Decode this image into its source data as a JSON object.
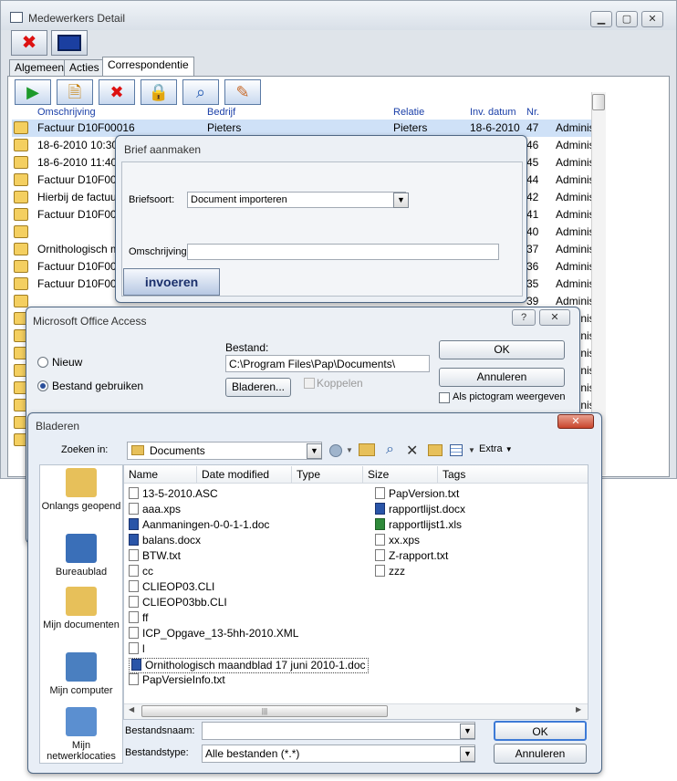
{
  "main_window": {
    "title": "Medewerkers Detail",
    "caption_min": "▁",
    "caption_max": "▢",
    "caption_close": "✕"
  },
  "tabs": [
    "Algemeen",
    "Acties",
    "Correspondentie"
  ],
  "grid": {
    "headers": {
      "omschrijving": "Omschrijving",
      "bedrijf": "Bedrijf",
      "relatie": "Relatie",
      "inv_datum": "Inv. datum",
      "nr": "Nr."
    },
    "rows": [
      {
        "omschrijving": "Factuur D10F00016",
        "bedrijf": "Pieters",
        "relatie": "Pieters",
        "datum": "18-6-2010",
        "nr": "47",
        "extra": "Administ"
      },
      {
        "omschrijving": "18-6-2010 10:30:0",
        "bedrijf": "",
        "relatie": "",
        "datum": "",
        "nr": "46",
        "extra": "Administ"
      },
      {
        "omschrijving": "18-6-2010 11:40:5",
        "bedrijf": "",
        "relatie": "",
        "datum": "",
        "nr": "45",
        "extra": "Administ"
      },
      {
        "omschrijving": "Factuur D10F0001",
        "bedrijf": "",
        "relatie": "",
        "datum": "",
        "nr": "44",
        "extra": "Administ"
      },
      {
        "omschrijving": "Hierbij de factuur v",
        "bedrijf": "",
        "relatie": "",
        "datum": "",
        "nr": "42",
        "extra": "Administ"
      },
      {
        "omschrijving": "Factuur D10F0001",
        "bedrijf": "",
        "relatie": "",
        "datum": "",
        "nr": "41",
        "extra": "Administ"
      },
      {
        "omschrijving": "",
        "bedrijf": "",
        "relatie": "",
        "datum": "",
        "nr": "40",
        "extra": "Administ"
      },
      {
        "omschrijving": "Ornithologisch maa",
        "bedrijf": "",
        "relatie": "",
        "datum": "",
        "nr": "37",
        "extra": "Administ"
      },
      {
        "omschrijving": "Factuur D10F0000",
        "bedrijf": "",
        "relatie": "",
        "datum": "",
        "nr": "36",
        "extra": "Administ"
      },
      {
        "omschrijving": "Factuur D10F0001",
        "bedrijf": "",
        "relatie": "",
        "datum": "",
        "nr": "35",
        "extra": "Administ"
      },
      {
        "omschrijving": "",
        "bedrijf": "",
        "relatie": "",
        "datum": "",
        "nr": "39",
        "extra": "Administ"
      },
      {
        "omschrijving": "",
        "bedrijf": "",
        "relatie": "",
        "datum": "",
        "nr": "",
        "extra": "Administ"
      },
      {
        "omschrijving": "",
        "bedrijf": "",
        "relatie": "",
        "datum": "",
        "nr": "",
        "extra": "Administ"
      },
      {
        "omschrijving": "",
        "bedrijf": "",
        "relatie": "",
        "datum": "",
        "nr": "",
        "extra": "Administ"
      },
      {
        "omschrijving": "",
        "bedrijf": "",
        "relatie": "",
        "datum": "",
        "nr": "",
        "extra": "Administ"
      },
      {
        "omschrijving": "",
        "bedrijf": "",
        "relatie": "",
        "datum": "",
        "nr": "",
        "extra": "Administ"
      },
      {
        "omschrijving": "",
        "bedrijf": "",
        "relatie": "",
        "datum": "",
        "nr": "",
        "extra": "Administ"
      },
      {
        "omschrijving": "",
        "bedrijf": "",
        "relatie": "",
        "datum": "",
        "nr": "",
        "extra": "Administ"
      },
      {
        "omschrijving": "",
        "bedrijf": "",
        "relatie": "",
        "datum": "",
        "nr": "",
        "extra": "Administ"
      }
    ]
  },
  "brief": {
    "title": "Brief aanmaken",
    "briefsoort_label": "Briefsoort:",
    "briefsoort_value": "Document importeren",
    "omschrijving_label": "Omschrijving:",
    "omschrijving_value": "",
    "invoeren": "invoeren"
  },
  "access": {
    "title": "Microsoft Office Access",
    "help": "?",
    "close": "✕",
    "nieuw": "Nieuw",
    "bestand_gebruiken": "Bestand gebruiken",
    "bestand_label": "Bestand:",
    "bestand_value": "C:\\Program Files\\Pap\\Documents\\",
    "bladeren": "Bladeren...",
    "koppelen": "Koppelen",
    "ok": "OK",
    "annuleren": "Annuleren",
    "als_pictogram": "Als pictogram weergeven"
  },
  "browse": {
    "title": "Bladeren",
    "close": "✕",
    "zoeken_in_label": "Zoeken in:",
    "zoeken_in_value": "Documents",
    "extra": "Extra",
    "columns": [
      "Name",
      "Date modified",
      "Type",
      "Size",
      "Tags"
    ],
    "places": [
      {
        "label": "Onlangs geopend"
      },
      {
        "label": "Bureaublad"
      },
      {
        "label": "Mijn documenten"
      },
      {
        "label": "Mijn computer"
      },
      {
        "label": "Mijn netwerklocaties"
      }
    ],
    "files_left": [
      {
        "name": "13-5-2010.ASC",
        "kind": "generic"
      },
      {
        "name": "aaa.xps",
        "kind": "generic"
      },
      {
        "name": "Aanmaningen-0-0-1-1.doc",
        "kind": "word"
      },
      {
        "name": "balans.docx",
        "kind": "word"
      },
      {
        "name": "BTW.txt",
        "kind": "generic"
      },
      {
        "name": "cc",
        "kind": "generic"
      },
      {
        "name": "CLIEOP03.CLI",
        "kind": "generic"
      },
      {
        "name": "CLIEOP03bb.CLI",
        "kind": "generic"
      },
      {
        "name": "ff",
        "kind": "generic"
      },
      {
        "name": "ICP_Opgave_13-5hh-2010.XML",
        "kind": "generic"
      },
      {
        "name": "l",
        "kind": "generic"
      },
      {
        "name": "Ornithologisch maandblad 17 juni 2010-1.doc",
        "kind": "word"
      },
      {
        "name": "PapVersieInfo.txt",
        "kind": "generic"
      }
    ],
    "files_right": [
      {
        "name": "PapVersion.txt",
        "kind": "generic"
      },
      {
        "name": "rapportlijst.docx",
        "kind": "word"
      },
      {
        "name": "rapportlijst1.xls",
        "kind": "xl"
      },
      {
        "name": "xx.xps",
        "kind": "generic"
      },
      {
        "name": "Z-rapport.txt",
        "kind": "generic"
      },
      {
        "name": "zzz",
        "kind": "generic"
      }
    ],
    "bestandsnaam_label": "Bestandsnaam:",
    "bestandsnaam_value": "",
    "bestandstype_label": "Bestandstype:",
    "bestandstype_value": "Alle bestanden (*.*)",
    "ok": "OK",
    "annuleren": "Annuleren"
  }
}
